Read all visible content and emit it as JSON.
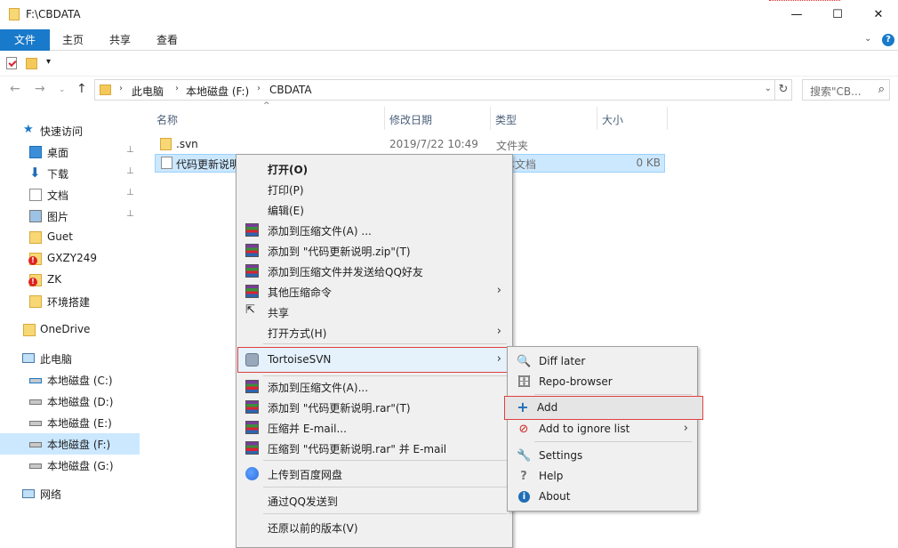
{
  "window": {
    "title": "F:\\CBDATA",
    "min": "—",
    "max": "☐",
    "close": "✕"
  },
  "ribbon": {
    "file": "文件",
    "home": "主页",
    "share": "共享",
    "view": "查看",
    "help": "?"
  },
  "nav": {
    "back": "←",
    "forward": "→",
    "recent": "⌄",
    "up": "↑",
    "crumbs": [
      "此电脑",
      "本地磁盘 (F:)",
      "CBDATA"
    ],
    "refresh": "↻",
    "search_placeholder": "搜索\"CB...",
    "search_icon": "⌕"
  },
  "sidebar": {
    "quick_access": "快速访问",
    "items": [
      {
        "label": "桌面",
        "pinned": true
      },
      {
        "label": "下载",
        "pinned": true
      },
      {
        "label": "文档",
        "pinned": true
      },
      {
        "label": "图片",
        "pinned": true
      },
      {
        "label": "Guet"
      },
      {
        "label": "GXZY249"
      },
      {
        "label": "ZK"
      },
      {
        "label": "环境搭建"
      }
    ],
    "onedrive": "OneDrive",
    "thispc": "此电脑",
    "drives": [
      "本地磁盘 (C:)",
      "本地磁盘 (D:)",
      "本地磁盘 (E:)",
      "本地磁盘 (F:)",
      "本地磁盘 (G:)"
    ],
    "network": "网络",
    "pin_glyph": "📌"
  },
  "columns": {
    "name": "名称",
    "modified": "修改日期",
    "type": "类型",
    "size": "大小",
    "sort_glyph": "^"
  },
  "files": [
    {
      "name": ".svn",
      "modified": "2019/7/22 10:49",
      "type": "文件夹",
      "size": ""
    },
    {
      "name": "代码更新说明",
      "modified": "",
      "type": "本文档",
      "size": "0 KB"
    }
  ],
  "context_menu": {
    "open": "打开(O)",
    "print": "打印(P)",
    "edit": "编辑(E)",
    "add_archive": "添加到压缩文件(A) ...",
    "add_zip": "添加到 \"代码更新说明.zip\"(T)",
    "add_send_qq": "添加到压缩文件并发送给QQ好友",
    "other_compress": "其他压缩命令",
    "share": "共享",
    "open_with": "打开方式(H)",
    "tortoise": "TortoiseSVN",
    "rar_add": "添加到压缩文件(A)...",
    "rar_add_named": "添加到 \"代码更新说明.rar\"(T)",
    "rar_email": "压缩并 E-mail...",
    "rar_named_email": "压缩到 \"代码更新说明.rar\" 并 E-mail",
    "baidu": "上传到百度网盘",
    "qq_send": "通过QQ发送到",
    "restore": "还原以前的版本(V)",
    "arrow": "›"
  },
  "svn_menu": {
    "diff_later": "Diff later",
    "repo_browser": "Repo-browser",
    "add": "Add",
    "add_ignore": "Add to ignore list",
    "settings": "Settings",
    "help": "Help",
    "about": "About",
    "icons": {
      "diff": "🔍",
      "repo": "🗄",
      "add": "+",
      "ignore": "⊘",
      "settings": "🔧",
      "help": "?",
      "about": "i"
    }
  }
}
